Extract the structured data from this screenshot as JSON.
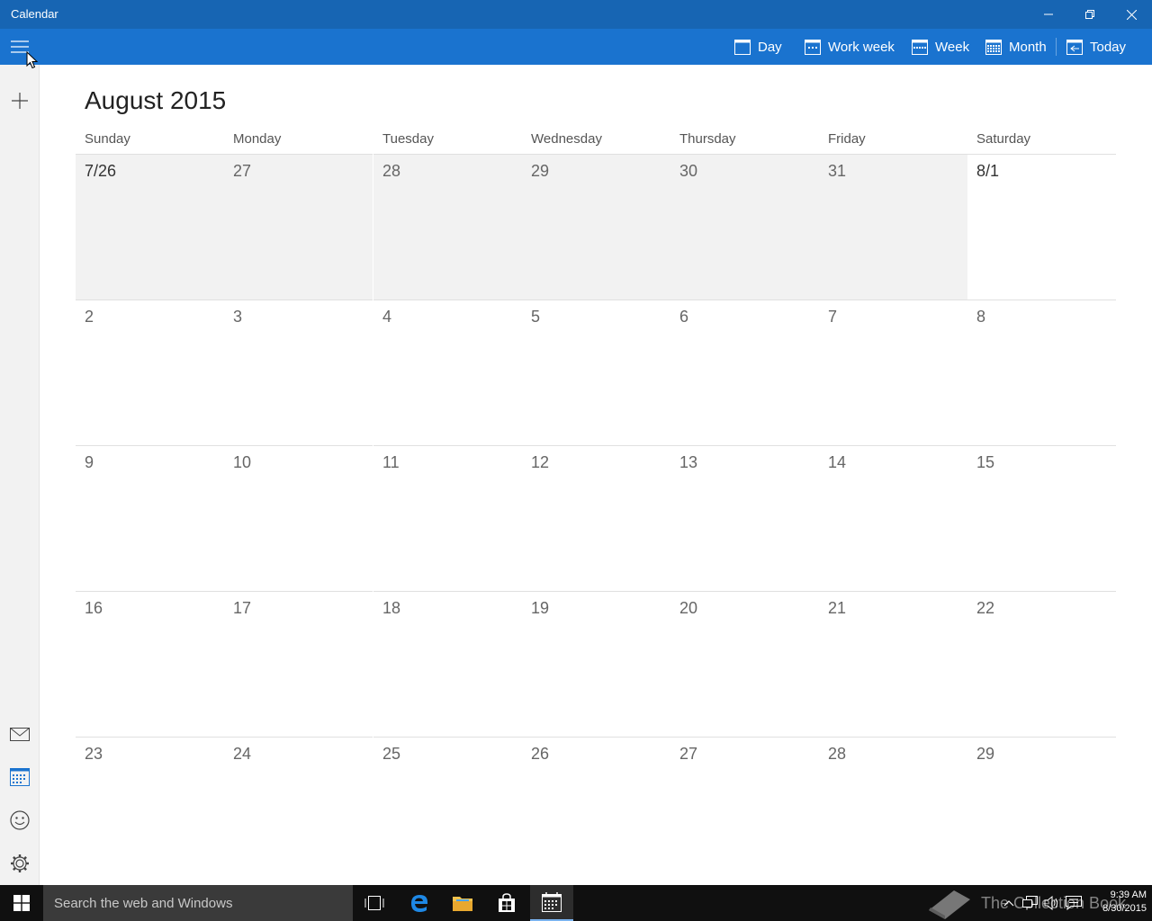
{
  "window": {
    "title": "Calendar"
  },
  "commands": {
    "day": "Day",
    "work_week": "Work week",
    "week": "Week",
    "month": "Month",
    "today": "Today"
  },
  "month_title": "August 2015",
  "weekdays": [
    "Sunday",
    "Monday",
    "Tuesday",
    "Wednesday",
    "Thursday",
    "Friday",
    "Saturday"
  ],
  "weeks": [
    [
      "7/26",
      "27",
      "28",
      "29",
      "30",
      "31",
      "8/1"
    ],
    [
      "2",
      "3",
      "4",
      "5",
      "6",
      "7",
      "8"
    ],
    [
      "9",
      "10",
      "11",
      "12",
      "13",
      "14",
      "15"
    ],
    [
      "16",
      "17",
      "18",
      "19",
      "20",
      "21",
      "22"
    ],
    [
      "23",
      "24",
      "25",
      "26",
      "27",
      "28",
      "29"
    ]
  ],
  "out_of_month_days": 6,
  "taskbar": {
    "search_placeholder": "Search the web and Windows",
    "time": "9:39 AM",
    "date": "8/30/2015",
    "watermark": "The Collection Book"
  },
  "colors": {
    "titlebar": "#1765b3",
    "command_bar": "#1a73cf",
    "accent": "#1a73cf",
    "taskbar": "#101010"
  }
}
